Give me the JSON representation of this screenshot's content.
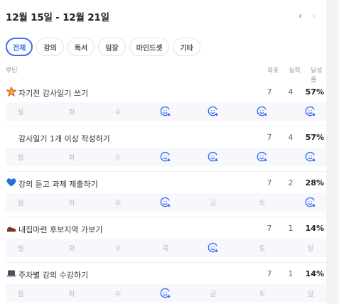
{
  "header": {
    "date_range": "12월 15일 - 12월 21일",
    "prev_icon": "chevron-left-icon",
    "next_icon": "chevron-right-icon"
  },
  "tabs": [
    {
      "label": "전체",
      "active": true
    },
    {
      "label": "강의",
      "active": false
    },
    {
      "label": "독서",
      "active": false
    },
    {
      "label": "임장",
      "active": false
    },
    {
      "label": "마인드셋",
      "active": false
    },
    {
      "label": "기타",
      "active": false
    }
  ],
  "columns": {
    "title": "루틴",
    "goal": "목표",
    "actual": "실적",
    "rate": "달성률"
  },
  "colors": {
    "accent": "#3d6cf5",
    "muted": "#bdbdbd",
    "row_bg": "#f6f8fb"
  },
  "routines": [
    {
      "icon": "sparkle-star-icon",
      "name": "자기전 감사일기 쓰기",
      "goal": "7",
      "actual": "4",
      "rate": "57%",
      "days": [
        {
          "label": "월",
          "done": false
        },
        {
          "label": "화",
          "done": false
        },
        {
          "label": "수",
          "done": false
        },
        {
          "label": "목",
          "done": true
        },
        {
          "label": "금",
          "done": true
        },
        {
          "label": "토",
          "done": true
        },
        {
          "label": "일",
          "done": true
        }
      ]
    },
    {
      "icon": "",
      "name": "감사일기 1개 이상 작성하기",
      "goal": "7",
      "actual": "4",
      "rate": "57%",
      "days": [
        {
          "label": "월",
          "done": false
        },
        {
          "label": "화",
          "done": false
        },
        {
          "label": "수",
          "done": false
        },
        {
          "label": "목",
          "done": true
        },
        {
          "label": "금",
          "done": true
        },
        {
          "label": "토",
          "done": true
        },
        {
          "label": "일",
          "done": true
        }
      ]
    },
    {
      "icon": "blue-heart-icon",
      "name": "강의 듣고 과제 제출하기",
      "goal": "7",
      "actual": "2",
      "rate": "28%",
      "days": [
        {
          "label": "월",
          "done": false
        },
        {
          "label": "화",
          "done": false
        },
        {
          "label": "수",
          "done": false
        },
        {
          "label": "목",
          "done": true
        },
        {
          "label": "금",
          "done": false
        },
        {
          "label": "토",
          "done": false
        },
        {
          "label": "일",
          "done": true
        }
      ]
    },
    {
      "icon": "shoe-icon",
      "name": "내집마련 후보지역 가보기",
      "goal": "7",
      "actual": "1",
      "rate": "14%",
      "days": [
        {
          "label": "월",
          "done": false
        },
        {
          "label": "화",
          "done": false
        },
        {
          "label": "수",
          "done": false
        },
        {
          "label": "목",
          "done": false
        },
        {
          "label": "금",
          "done": true
        },
        {
          "label": "토",
          "done": false
        },
        {
          "label": "일",
          "done": false
        }
      ]
    },
    {
      "icon": "laptop-icon",
      "name": "주차별 강의 수강하기",
      "goal": "7",
      "actual": "1",
      "rate": "14%",
      "days": [
        {
          "label": "월",
          "done": false
        },
        {
          "label": "화",
          "done": false
        },
        {
          "label": "수",
          "done": false
        },
        {
          "label": "목",
          "done": true
        },
        {
          "label": "금",
          "done": false
        },
        {
          "label": "토",
          "done": false
        },
        {
          "label": "일",
          "done": false
        }
      ]
    }
  ]
}
